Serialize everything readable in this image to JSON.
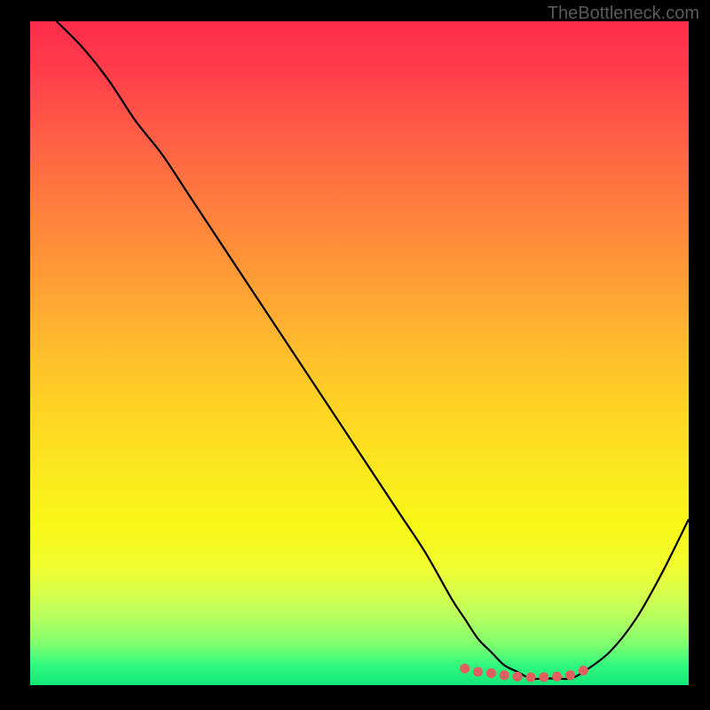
{
  "watermark": "TheBottleneck.com",
  "chart_data": {
    "type": "line",
    "title": "",
    "xlabel": "",
    "ylabel": "",
    "xlim": [
      0,
      100
    ],
    "ylim": [
      0,
      100
    ],
    "series": [
      {
        "name": "bottleneck-curve",
        "x": [
          4,
          8,
          12,
          16,
          20,
          24,
          28,
          32,
          36,
          40,
          44,
          48,
          52,
          56,
          60,
          64,
          66,
          68,
          70,
          72,
          74,
          76,
          78,
          80,
          82,
          84,
          88,
          92,
          96,
          100
        ],
        "y": [
          100,
          96,
          91,
          85,
          80,
          74,
          68,
          62,
          56,
          50,
          44,
          38,
          32,
          26,
          20,
          13,
          10,
          7,
          5,
          3,
          2,
          1,
          1,
          1,
          1,
          2,
          5,
          10,
          17,
          25
        ]
      }
    ],
    "markers": {
      "name": "optimal-range-dots",
      "x": [
        66,
        68,
        70,
        72,
        74,
        76,
        78,
        80,
        82,
        84
      ],
      "y": [
        2.5,
        2,
        1.8,
        1.5,
        1.3,
        1.2,
        1.2,
        1.3,
        1.5,
        2.2
      ]
    },
    "gradient_stops": [
      {
        "pos": 0,
        "color": "#ff2b4c"
      },
      {
        "pos": 50,
        "color": "#ffcc22"
      },
      {
        "pos": 80,
        "color": "#f8f818"
      },
      {
        "pos": 100,
        "color": "#14e878"
      }
    ]
  }
}
